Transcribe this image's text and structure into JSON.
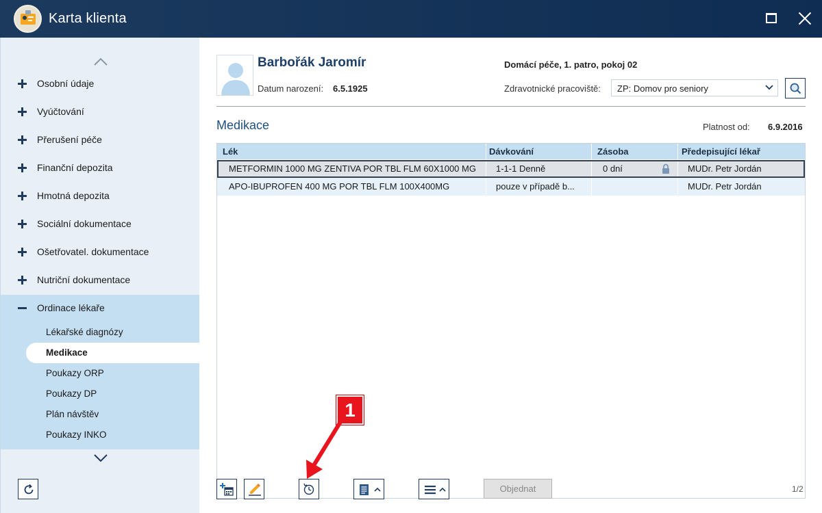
{
  "window": {
    "title": "Karta klienta",
    "maximize_icon": "maximize-icon",
    "close_icon": "close-icon"
  },
  "sidebar": {
    "items": [
      {
        "label": "Osobní údaje",
        "expanded": false
      },
      {
        "label": "Vyúčtování",
        "expanded": false
      },
      {
        "label": "Přerušení péče",
        "expanded": false
      },
      {
        "label": "Finanční depozita",
        "expanded": false
      },
      {
        "label": "Hmotná depozita",
        "expanded": false
      },
      {
        "label": "Sociální dokumentace",
        "expanded": false
      },
      {
        "label": "Ošetřovatel. dokumentace",
        "expanded": false
      },
      {
        "label": "Nutriční dokumentace",
        "expanded": false
      },
      {
        "label": "Ordinace lékaře",
        "expanded": true
      }
    ],
    "subitems": [
      {
        "label": "Lékařské diagnózy",
        "active": false
      },
      {
        "label": "Medikace",
        "active": true
      },
      {
        "label": "Poukazy ORP",
        "active": false
      },
      {
        "label": "Poukazy DP",
        "active": false
      },
      {
        "label": "Plán návštěv",
        "active": false
      },
      {
        "label": "Poukazy INKO",
        "active": false
      }
    ]
  },
  "client": {
    "name": "Barbořák Jaromír",
    "dob_label": "Datum narození:",
    "dob": "6.5.1925",
    "location": "Domácí péče, 1. patro, pokoj 02",
    "workplace_label": "Zdravotnické pracoviště:",
    "workplace": "ZP: Domov pro seniory"
  },
  "section": {
    "title": "Medikace",
    "valid_label": "Platnost od:",
    "valid_from": "6.9.2016"
  },
  "table": {
    "columns": [
      "Lék",
      "Dávkování",
      "Zásoba",
      "Předepisující lékař"
    ],
    "rows": [
      {
        "drug": "METFORMIN 1000 MG ZENTIVA POR TBL FLM 60X1000 MG",
        "dosage": "1-1-1 Denně",
        "stock": "0 dní",
        "doctor": "MUDr. Petr Jordán",
        "locked": true,
        "selected": true
      },
      {
        "drug": "APO-IBUPROFEN 400 MG POR TBL FLM 100X400MG",
        "dosage": "pouze v případě b...",
        "stock": "",
        "doctor": "MUDr. Petr Jordán",
        "locked": false,
        "selected": false
      }
    ]
  },
  "toolbar": {
    "add_icon": "add-calendar-icon",
    "edit_icon": "edit-pencil-icon",
    "history_icon": "history-clock-icon",
    "document_icon": "document-icon",
    "menu_icon": "menu-icon",
    "order_label": "Objednat",
    "page_indicator": "1/2"
  },
  "annotation": {
    "number": "1",
    "color": "#e8141e"
  }
}
